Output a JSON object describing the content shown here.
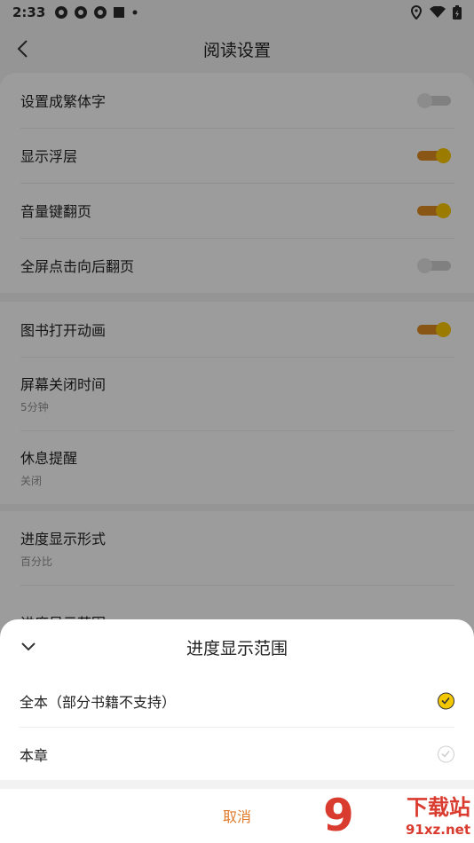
{
  "statusbar": {
    "time": "2:33"
  },
  "header": {
    "title": "阅读设置"
  },
  "sections": [
    {
      "rows": [
        {
          "label": "设置成繁体字",
          "toggle": "off"
        },
        {
          "label": "显示浮层",
          "toggle": "on"
        },
        {
          "label": "音量键翻页",
          "toggle": "on"
        },
        {
          "label": "全屏点击向后翻页",
          "toggle": "off"
        }
      ]
    },
    {
      "rows": [
        {
          "label": "图书打开动画",
          "toggle": "on"
        },
        {
          "label": "屏幕关闭时间",
          "sub": "5分钟"
        },
        {
          "label": "休息提醒",
          "sub": "关闭"
        }
      ]
    },
    {
      "rows": [
        {
          "label": "进度显示形式",
          "sub": "百分比"
        },
        {
          "label": "进度显示范围"
        }
      ]
    }
  ],
  "sheet": {
    "title": "进度显示范围",
    "options": [
      {
        "label": "全本（部分书籍不支持）",
        "selected": true
      },
      {
        "label": "本章",
        "selected": false
      }
    ],
    "cancel": "取消"
  },
  "watermark": {
    "brand": "下载站",
    "site": "91xz.net"
  },
  "colors": {
    "accent": "#f2c200",
    "toggle_track_on": "#d68722",
    "cancel": "#e07a2a"
  }
}
